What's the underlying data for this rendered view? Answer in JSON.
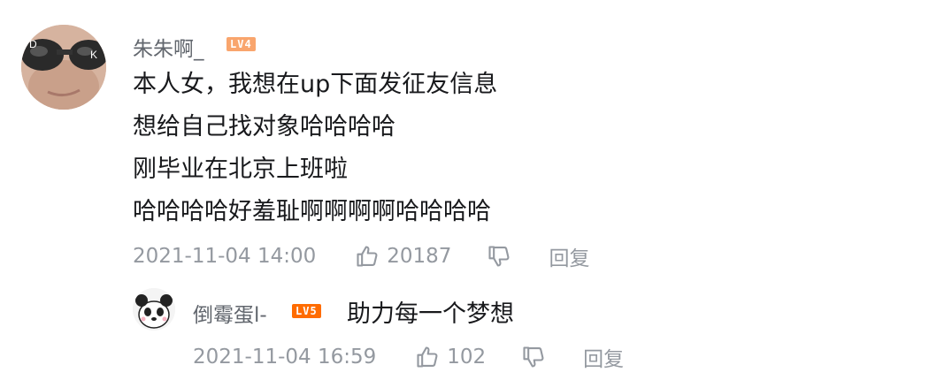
{
  "comment": {
    "username": "朱朱啊_",
    "level_badge": "LV4",
    "level_color": "#f9a56d",
    "lines": [
      "本人女，我想在up下面发征友信息",
      "想给自己找对象哈哈哈哈",
      "刚毕业在北京上班啦",
      "哈哈哈哈好羞耻啊啊啊啊哈哈哈哈"
    ],
    "timestamp": "2021-11-04 14:00",
    "likes": "20187",
    "reply_label": "回复"
  },
  "reply": {
    "username": "倒霉蛋l-",
    "level_badge": "LV5",
    "level_color": "#ff6c00",
    "text": "助力每一个梦想",
    "timestamp": "2021-11-04 16:59",
    "likes": "102",
    "reply_label": "回复"
  },
  "colors": {
    "text_primary": "#18191c",
    "text_secondary": "#61666d",
    "text_meta": "#9499a0"
  }
}
